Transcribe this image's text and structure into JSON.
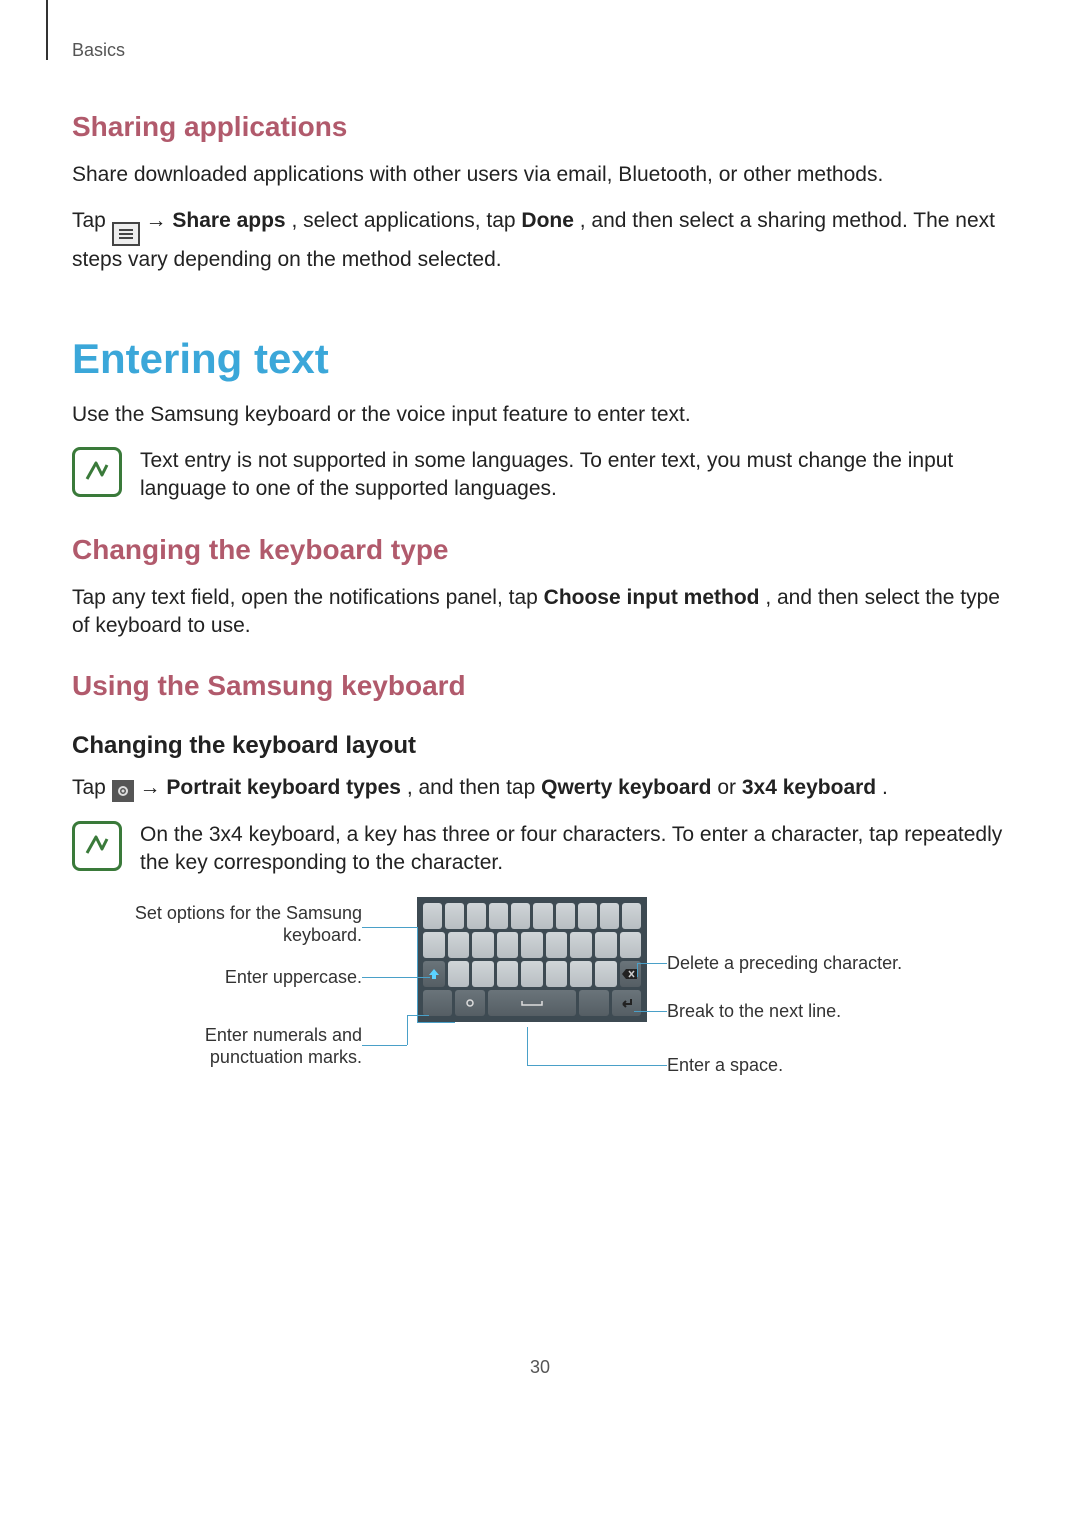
{
  "header": {
    "section": "Basics"
  },
  "sharing": {
    "heading": "Sharing applications",
    "intro": "Share downloaded applications with other users via email, Bluetooth, or other methods.",
    "tap": "Tap ",
    "arrow": " → ",
    "share_apps": "Share apps",
    "after_share": ", select applications, tap ",
    "done": "Done",
    "after_done": ", and then select a sharing method. The next steps vary depending on the method selected."
  },
  "entering": {
    "heading": "Entering text",
    "intro": "Use the Samsung keyboard or the voice input feature to enter text.",
    "note": "Text entry is not supported in some languages. To enter text, you must change the input language to one of the supported languages."
  },
  "changing_type": {
    "heading": "Changing the keyboard type",
    "para_a": "Tap any text field, open the notifications panel, tap ",
    "choose": "Choose input method",
    "para_b": ", and then select the type of keyboard to use."
  },
  "using_kb": {
    "heading": "Using the Samsung keyboard",
    "sub": "Changing the keyboard layout",
    "tap": "Tap ",
    "arrow": " → ",
    "portrait": "Portrait keyboard types",
    "between": ", and then tap ",
    "qwerty": "Qwerty keyboard",
    "or": " or ",
    "threebyfour": "3x4 keyboard",
    "period": ".",
    "note": "On the 3x4 keyboard, a key has three or four characters. To enter a character, tap repeatedly the key corresponding to the character."
  },
  "diagram": {
    "left1": "Set options for the Samsung keyboard.",
    "left2": "Enter uppercase.",
    "left3": "Enter numerals and punctuation marks.",
    "right1": "Delete a preceding character.",
    "right2": "Break to the next line.",
    "right3": "Enter a space."
  },
  "page_number": "30"
}
